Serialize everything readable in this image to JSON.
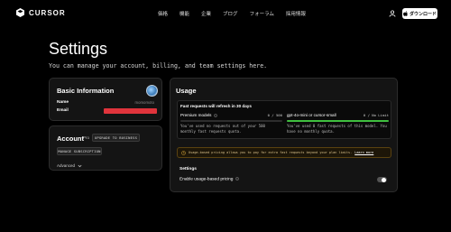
{
  "nav": {
    "brand": "CURSOR",
    "links": [
      "価格",
      "機能",
      "企業",
      "ブログ",
      "フォーラム",
      "採用情報"
    ],
    "download_label": "ダウンロード"
  },
  "page": {
    "title": "Settings",
    "subtitle": "You can manage your account, billing, and team settings here."
  },
  "basic_info": {
    "heading": "Basic Information",
    "name_label": "Name",
    "name_value": "momomoto",
    "email_label": "Email"
  },
  "account": {
    "heading": "Account",
    "plan": "Pro",
    "upgrade_label": "UPGRADE TO BUSINESS",
    "manage_label": "MANAGE SUBSCRIPTION",
    "advanced_label": "Advanced"
  },
  "usage": {
    "heading": "Usage",
    "refresh_note": "Fast requests will refresh in 30 days",
    "premium": {
      "name": "Premium models",
      "value": "0 / 500",
      "progress": 0,
      "desc": "You've used no requests out of your 500 monthly fast requests quota."
    },
    "mini": {
      "name": "gpt-4o-mini or cursor-small",
      "value": "0 / No Limit",
      "progress": 1,
      "desc": "You've used 0 fast requests of this model. You have no monthly quota."
    },
    "notice_text": "Usage-based pricing allows you to pay for extra fast requests beyond your plan limits.",
    "notice_link": "Learn more",
    "settings_heading": "Settings",
    "usage_pricing_label": "Enable usage-based pricing"
  },
  "colors": {
    "progress_green": "#3fbf3f",
    "redaction_red": "#e0343c",
    "notice_border": "#5a4210"
  }
}
